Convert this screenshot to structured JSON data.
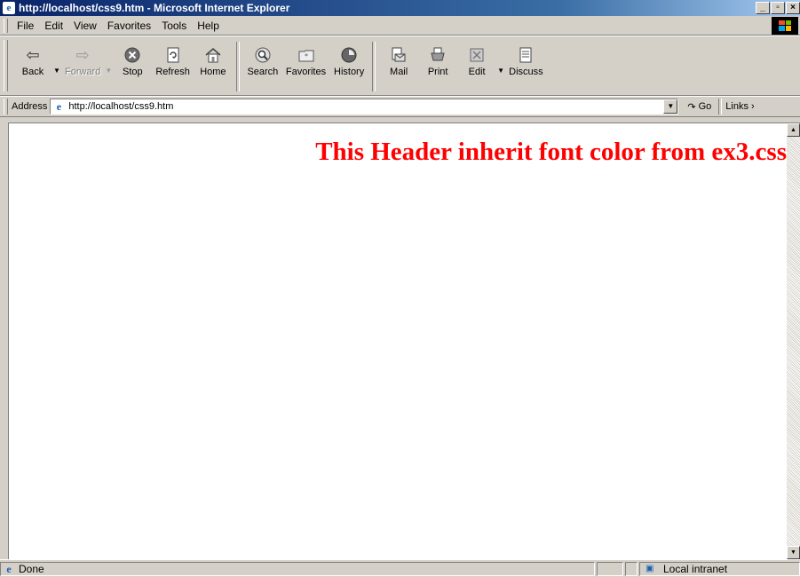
{
  "window": {
    "title": "http://localhost/css9.htm - Microsoft Internet Explorer",
    "controls": [
      "_",
      "□",
      "×"
    ]
  },
  "menu": [
    {
      "label": "File"
    },
    {
      "label": "Edit"
    },
    {
      "label": "View"
    },
    {
      "label": "Favorites"
    },
    {
      "label": "Tools"
    },
    {
      "label": "Help"
    }
  ],
  "toolbar": {
    "back": "Back",
    "forward": "Forward",
    "stop": "Stop",
    "refresh": "Refresh",
    "home": "Home",
    "search": "Search",
    "favorites": "Favorites",
    "history": "History",
    "mail": "Mail",
    "print": "Print",
    "edit": "Edit",
    "discuss": "Discuss"
  },
  "address": {
    "label": "Address",
    "url": "http://localhost/css9.htm",
    "go": "Go",
    "links": "Links"
  },
  "page": {
    "heading": "This Header inherit font color from ex3.css",
    "heading_color": "#ff0000"
  },
  "status": {
    "text": "Done",
    "zone": "Local intranet"
  }
}
